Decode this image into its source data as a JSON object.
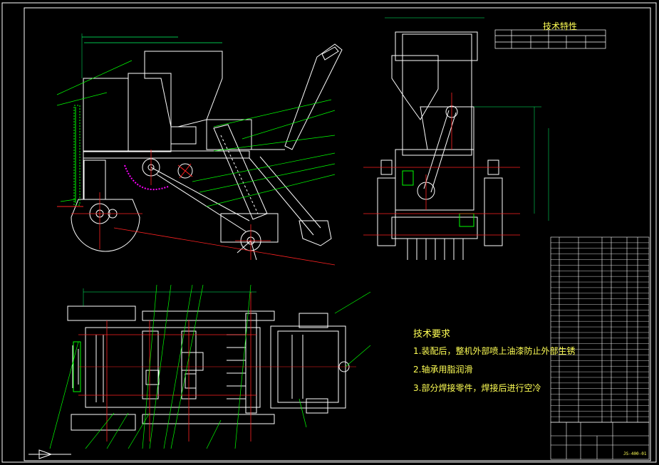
{
  "tech_spec": {
    "title": "技术特性"
  },
  "tech_requirements": {
    "title": "技术要求",
    "items": [
      "1.装配后，整机外部喷上油漆防止外部生锈",
      "2.轴承用脂润滑",
      "3.部分焊接零件，焊接后进行空冷"
    ]
  },
  "title_block": {
    "drawing_no": "JS-400-01"
  },
  "colors": {
    "background": "#000000",
    "frame": "#ffffff",
    "outline": "#ffffff",
    "leader": "#00ff00",
    "centerline": "#ff2222",
    "dimension": "#00ff66",
    "hatch": "#ff00ff",
    "annotation": "#ffff55"
  }
}
